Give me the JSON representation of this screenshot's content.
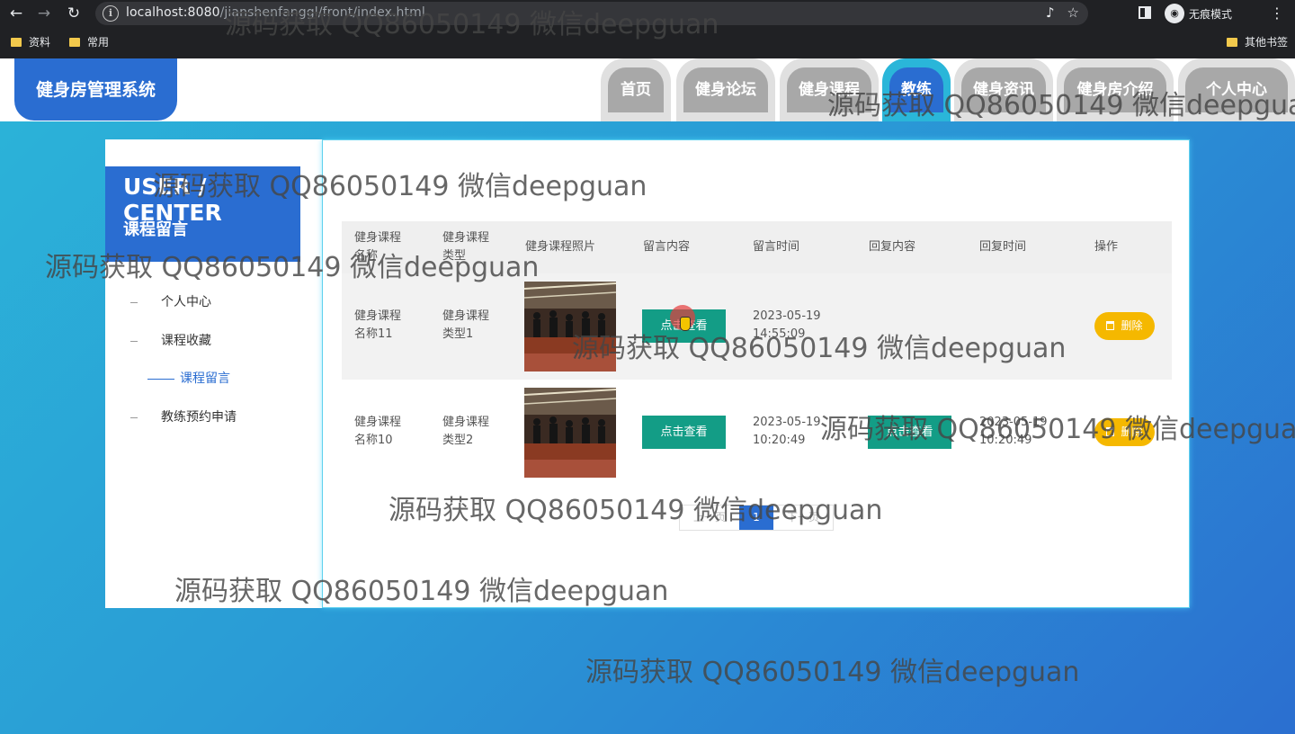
{
  "browser": {
    "url_host": "localhost:8080",
    "url_path": "/jianshenfanggl/front/index.html",
    "profile_label": "无痕模式",
    "bookmarks": [
      "资料",
      "常用"
    ],
    "other_bookmarks": "其他书签"
  },
  "site": {
    "logo": "健身房管理系统",
    "nav": [
      {
        "label": "首页",
        "active": false
      },
      {
        "label": "健身论坛",
        "active": false
      },
      {
        "label": "健身课程",
        "active": false
      },
      {
        "label": "教练",
        "active": true
      },
      {
        "label": "健身资讯",
        "active": false
      },
      {
        "label": "健身房介绍",
        "active": false
      },
      {
        "label": "个人中心",
        "active": false
      }
    ]
  },
  "sidebar": {
    "title_en": "USER / CENTER",
    "title_cn": "课程留言",
    "items": [
      {
        "label": "个人中心",
        "active": false
      },
      {
        "label": "课程收藏",
        "active": false
      },
      {
        "label": "课程留言",
        "active": true
      },
      {
        "label": "教练预约申请",
        "active": false
      }
    ]
  },
  "table": {
    "headers": [
      "健身课程名称",
      "健身课程类型",
      "健身课程照片",
      "留言内容",
      "留言时间",
      "回复内容",
      "回复时间",
      "操作"
    ],
    "rows": [
      {
        "name": "健身课程名称11",
        "type": "健身课程类型1",
        "content_button": "点击查看",
        "time_date": "2023-05-19",
        "time_clock": "14:55:09",
        "reply_button": "",
        "reply_date": "",
        "reply_clock": "",
        "delete_label": "删除"
      },
      {
        "name": "健身课程名称10",
        "type": "健身课程类型2",
        "content_button": "点击查看",
        "time_date": "2023-05-19",
        "time_clock": "10:20:49",
        "reply_button": "点击查看",
        "reply_date": "2023-05-19",
        "reply_clock": "10:20:49",
        "delete_label": "删除"
      }
    ]
  },
  "pagination": {
    "prev": "上一页",
    "current": "1",
    "next": "下一页"
  },
  "watermark": "源码获取 QQ86050149 微信deepguan",
  "colors": {
    "primary": "#2a6dd1",
    "accent": "#2ab6d9",
    "view_button": "#139d86",
    "delete_button": "#f5b800"
  }
}
